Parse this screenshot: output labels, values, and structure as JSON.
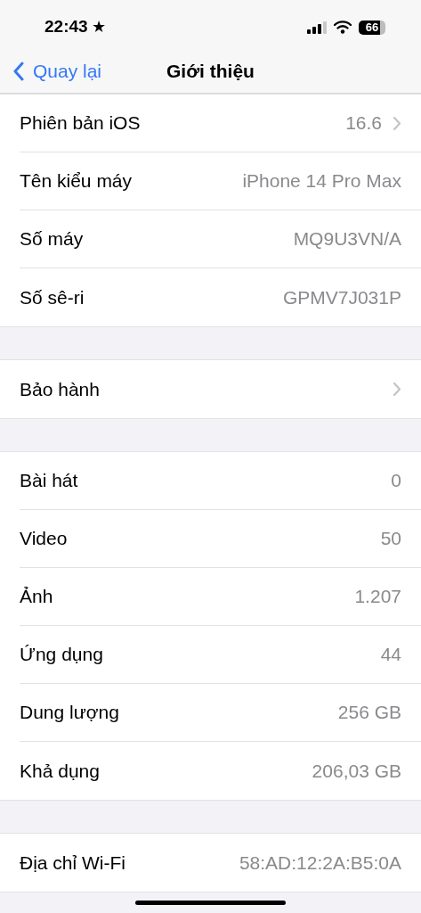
{
  "status_bar": {
    "time": "22:43",
    "star": "★",
    "battery": "66"
  },
  "nav": {
    "back": "Quay lại",
    "title": "Giới thiệu"
  },
  "groups": [
    {
      "rows": [
        {
          "label": "Phiên bản iOS",
          "value": "16.6",
          "disclosure": true
        },
        {
          "label": "Tên kiểu máy",
          "value": "iPhone 14 Pro Max",
          "disclosure": false
        },
        {
          "label": "Số máy",
          "value": "MQ9U3VN/A",
          "disclosure": false
        },
        {
          "label": "Số sê-ri",
          "value": "GPMV7J031P",
          "disclosure": false
        }
      ]
    },
    {
      "rows": [
        {
          "label": "Bảo hành",
          "disclosure": true
        }
      ]
    },
    {
      "rows": [
        {
          "label": "Bài hát",
          "value": "0",
          "disclosure": false
        },
        {
          "label": "Video",
          "value": "50",
          "disclosure": false
        },
        {
          "label": "Ảnh",
          "value": "1.207",
          "disclosure": false
        },
        {
          "label": "Ứng dụng",
          "value": "44",
          "disclosure": false
        },
        {
          "label": "Dung lượng",
          "value": "256 GB",
          "disclosure": false
        },
        {
          "label": "Khả dụng",
          "value": "206,03 GB",
          "disclosure": false
        }
      ]
    },
    {
      "rows": [
        {
          "label": "Địa chỉ Wi-Fi",
          "value": "58:AD:12:2A:B5:0A",
          "disclosure": false
        }
      ]
    }
  ]
}
